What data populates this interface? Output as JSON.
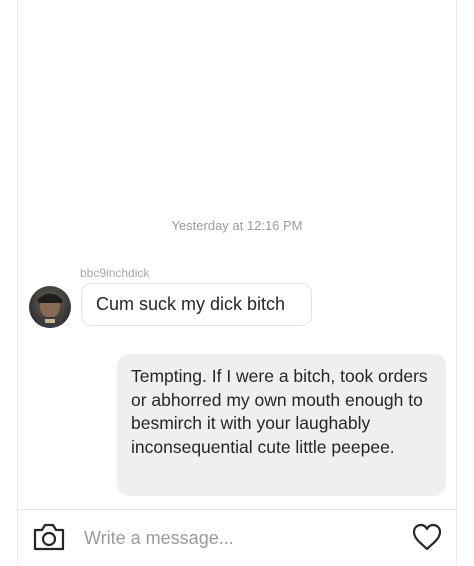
{
  "thread": {
    "timestamp": "Yesterday at 12:16 PM",
    "incoming": {
      "sender": "bbc9inchdick",
      "text": "Cum suck my dick bitch"
    },
    "outgoing": {
      "text": "Tempting. If I were a bitch, took orders or abhorred my own mouth enough to besmirch it with your laughably inconsequential cute little peepee."
    }
  },
  "composer": {
    "placeholder": "Write a message...",
    "camera_icon": "camera-icon",
    "like_icon": "heart-icon"
  }
}
